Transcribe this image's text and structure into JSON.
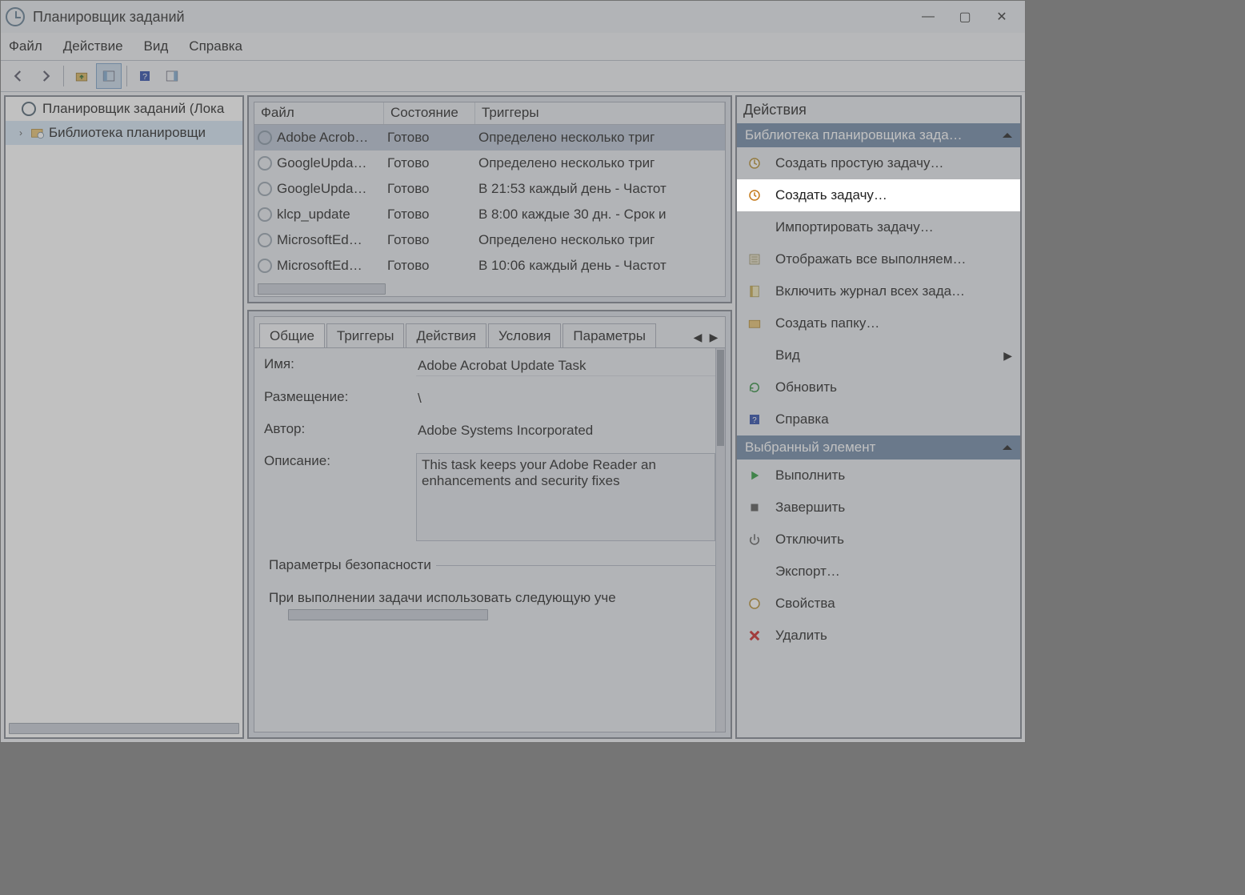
{
  "window": {
    "title": "Планировщик заданий"
  },
  "menu": {
    "file": "Файл",
    "action": "Действие",
    "view": "Вид",
    "help": "Справка"
  },
  "tree": {
    "root": "Планировщик заданий (Лока",
    "lib": "Библиотека планировщи"
  },
  "grid": {
    "headers": {
      "file": "Файл",
      "state": "Состояние",
      "triggers": "Триггеры"
    },
    "rows": [
      {
        "name": "Adobe Acrob…",
        "state": "Готово",
        "trigger": "Определено несколько триг"
      },
      {
        "name": "GoogleUpda…",
        "state": "Готово",
        "trigger": "Определено несколько триг"
      },
      {
        "name": "GoogleUpda…",
        "state": "Готово",
        "trigger": "В 21:53 каждый день - Частот"
      },
      {
        "name": "klcp_update",
        "state": "Готово",
        "trigger": "В 8:00 каждые 30 дн. - Срок и"
      },
      {
        "name": "MicrosoftEd…",
        "state": "Готово",
        "trigger": "Определено несколько триг"
      },
      {
        "name": "MicrosoftEd…",
        "state": "Готово",
        "trigger": "В 10:06 каждый день - Частот"
      }
    ]
  },
  "tabs": {
    "general": "Общие",
    "triggers": "Триггеры",
    "actions": "Действия",
    "conditions": "Условия",
    "settings": "Параметры"
  },
  "general": {
    "name_lbl": "Имя:",
    "name_val": "Adobe Acrobat Update Task",
    "loc_lbl": "Размещение:",
    "loc_val": "\\",
    "author_lbl": "Автор:",
    "author_val": "Adobe Systems Incorporated",
    "desc_lbl": "Описание:",
    "desc_val": "This task keeps your Adobe Reader an enhancements and security fixes",
    "sec_legend": "Параметры безопасности",
    "sec_line": "При выполнении задачи использовать следующую уче"
  },
  "actions": {
    "pane_title": "Действия",
    "section1": "Библиотека планировщика зада…",
    "items1": [
      "Создать простую задачу…",
      "Создать задачу…",
      "Импортировать задачу…",
      "Отображать все выполняем…",
      "Включить журнал всех зада…",
      "Создать папку…",
      "Вид",
      "Обновить",
      "Справка"
    ],
    "section2": "Выбранный элемент",
    "items2": [
      "Выполнить",
      "Завершить",
      "Отключить",
      "Экспорт…",
      "Свойства",
      "Удалить"
    ]
  }
}
